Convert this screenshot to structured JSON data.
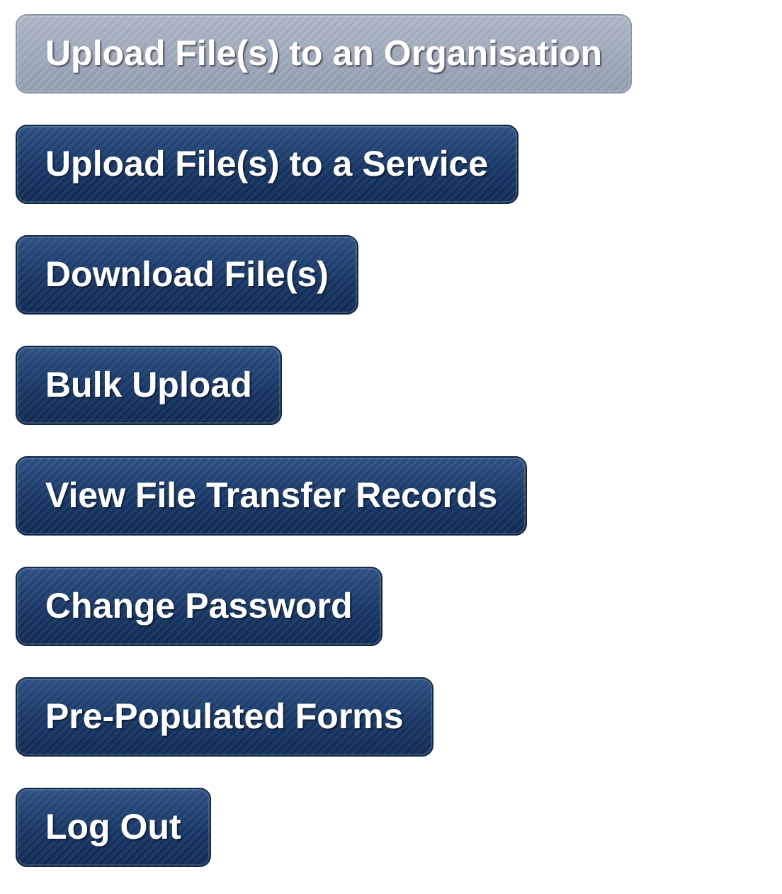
{
  "buttons": [
    {
      "label": "Upload File(s) to an Organisation",
      "disabled": true
    },
    {
      "label": "Upload File(s) to a Service",
      "disabled": false
    },
    {
      "label": "Download File(s)",
      "disabled": false
    },
    {
      "label": "Bulk Upload",
      "disabled": false
    },
    {
      "label": "View File Transfer Records",
      "disabled": false
    },
    {
      "label": "Change Password",
      "disabled": false
    },
    {
      "label": "Pre-Populated Forms",
      "disabled": false
    },
    {
      "label": "Log Out",
      "disabled": false
    }
  ]
}
